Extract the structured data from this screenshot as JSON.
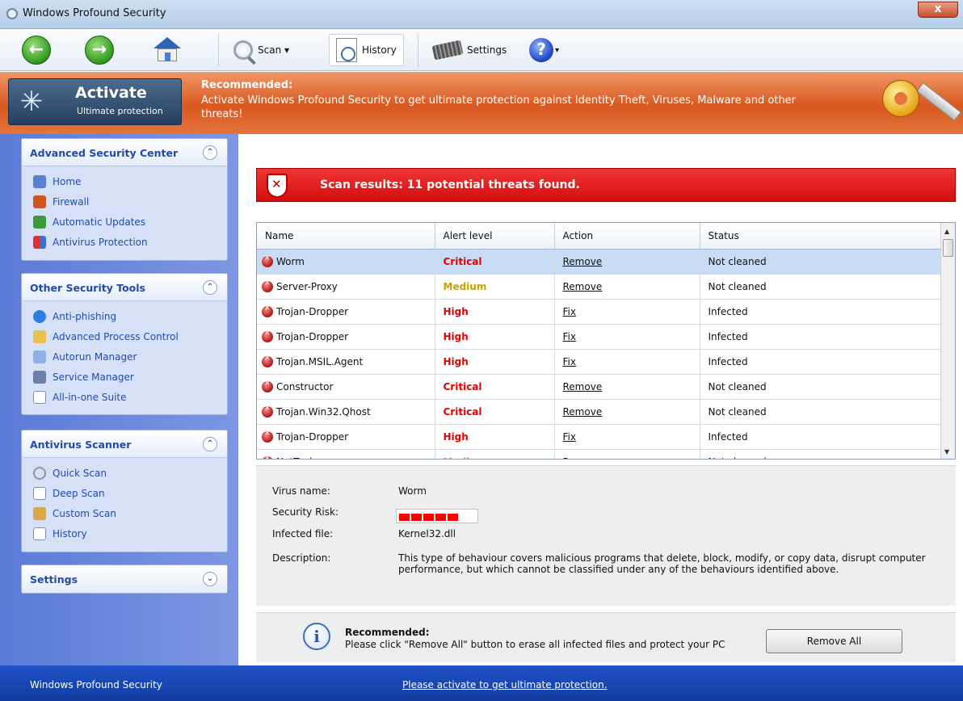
{
  "window": {
    "title": "Windows Profound Security",
    "close": "x"
  },
  "toolbar": {
    "back_icon": "back-arrow-icon",
    "forward_icon": "forward-arrow-icon",
    "home_icon": "home-icon",
    "scan_label": "Scan ▾",
    "history_label": "History",
    "settings_label": "Settings",
    "help_label": "?",
    "help_caret": "▾"
  },
  "banner": {
    "activate_title": "Activate",
    "activate_subtitle": "Ultimate protection",
    "recommended_title": "Recommended:",
    "recommended_text": "Activate Windows Profound Security to get ultimate protection against Identity Theft, Viruses, Malware and other threats!"
  },
  "sidebar": {
    "panels": [
      {
        "title": "Advanced Security Center",
        "toggle": "⌃",
        "items": [
          {
            "label": "Home",
            "icon": "home-icon"
          },
          {
            "label": "Firewall",
            "icon": "firewall-icon"
          },
          {
            "label": "Automatic Updates",
            "icon": "updates-icon"
          },
          {
            "label": "Antivirus Protection",
            "icon": "shield-icon"
          }
        ]
      },
      {
        "title": "Other Security Tools",
        "toggle": "⌃",
        "items": [
          {
            "label": "Anti-phishing",
            "icon": "browser-icon"
          },
          {
            "label": "Advanced Process Control",
            "icon": "process-icon"
          },
          {
            "label": "Autorun Manager",
            "icon": "autorun-icon"
          },
          {
            "label": "Service Manager",
            "icon": "service-icon"
          },
          {
            "label": "All-in-one Suite",
            "icon": "suite-icon"
          }
        ]
      },
      {
        "title": "Antivirus Scanner",
        "toggle": "⌃",
        "items": [
          {
            "label": "Quick Scan",
            "icon": "magnifier-icon"
          },
          {
            "label": "Deep Scan",
            "icon": "deep-scan-icon"
          },
          {
            "label": "Custom Scan",
            "icon": "custom-scan-icon"
          },
          {
            "label": "History",
            "icon": "history-icon"
          }
        ]
      },
      {
        "title": "Settings",
        "toggle": "⌄",
        "items": []
      }
    ]
  },
  "scan": {
    "headline": "Scan results: 11 potential threats found."
  },
  "table": {
    "columns": [
      "Name",
      "Alert level",
      "Action",
      "Status"
    ],
    "rows": [
      {
        "name": "Worm",
        "level": "Critical",
        "action": "Remove",
        "status": "Not cleaned"
      },
      {
        "name": "Server-Proxy",
        "level": "Medium",
        "action": "Remove",
        "status": "Not cleaned"
      },
      {
        "name": "Trojan-Dropper",
        "level": "High",
        "action": "Fix",
        "status": "Infected"
      },
      {
        "name": "Trojan-Dropper",
        "level": "High",
        "action": "Fix",
        "status": "Infected"
      },
      {
        "name": "Trojan.MSIL.Agent",
        "level": "High",
        "action": "Fix",
        "status": "Infected"
      },
      {
        "name": "Constructor",
        "level": "Critical",
        "action": "Remove",
        "status": "Not cleaned"
      },
      {
        "name": "Trojan.Win32.Qhost",
        "level": "Critical",
        "action": "Remove",
        "status": "Not cleaned"
      },
      {
        "name": "Trojan-Dropper",
        "level": "High",
        "action": "Fix",
        "status": "Infected"
      },
      {
        "name": "NetTool",
        "level": "Medium",
        "action": "Remove",
        "status": "Not cleaned"
      }
    ],
    "level_colors": {
      "Critical": "#e30000",
      "High": "#e30000",
      "Medium": "#c9a100"
    }
  },
  "details": {
    "virus_name_label": "Virus name:",
    "virus_name": "Worm",
    "risk_label": "Security Risk:",
    "risk_blocks": 5,
    "file_label": "Infected file:",
    "file": "Kernel32.dll",
    "desc_label": "Description:",
    "description": "This type of behaviour covers malicious programs that delete, block, modify, or copy data, disrupt computer performance, but which cannot be classified under any of the behaviours identified above."
  },
  "recommend": {
    "title": "Recommended:",
    "text": "Please click \"Remove All\" button to erase all infected files and protect your PC",
    "button": "Remove All"
  },
  "footer": {
    "left": "Windows Profound Security",
    "link": "Please activate to get ultimate protection."
  }
}
